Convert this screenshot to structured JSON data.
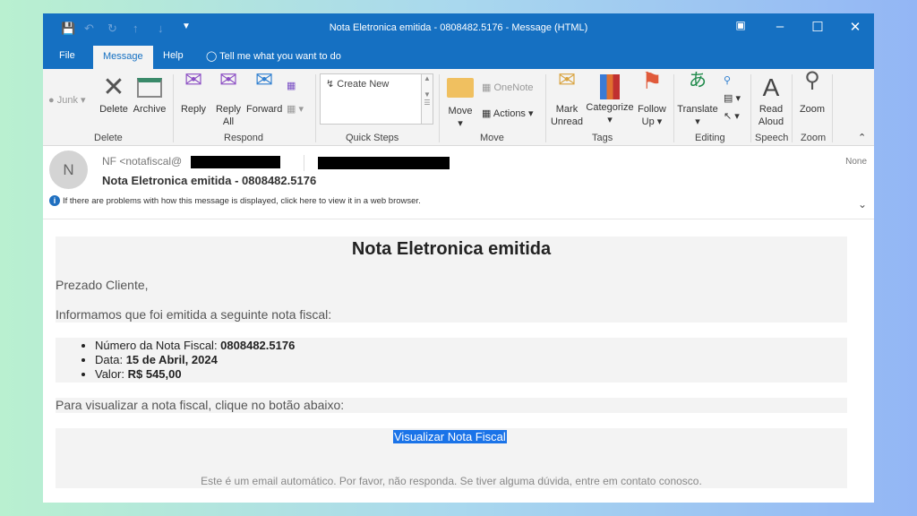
{
  "window": {
    "title": "Nota Eletronica emitida - 0808482.5176  -  Message (HTML)"
  },
  "tabs": [
    {
      "label": "File"
    },
    {
      "label": "Message"
    },
    {
      "label": "Help"
    }
  ],
  "tell_me": "Tell me what you want to do",
  "ribbon": {
    "junk": "Junk",
    "delete": "Delete",
    "archive": "Archive",
    "reply": "Reply",
    "reply_all": "Reply All",
    "forward": "Forward",
    "quick_steps_item": "Create New",
    "move": "Move",
    "onenote": "OneNote",
    "actions": "Actions",
    "mark_unread": "Mark Unread",
    "categorize": "Categorize",
    "follow_up": "Follow Up",
    "translate": "Translate",
    "read_aloud": "Read Aloud",
    "zoom": "Zoom",
    "groups": [
      "Delete",
      "Respond",
      "Quick Steps",
      "Move",
      "Tags",
      "Editing",
      "Speech",
      "Zoom"
    ]
  },
  "header": {
    "avatar_initial": "N",
    "from": "NF <notafiscal@",
    "from_end": ">",
    "subject": "Nota Eletronica emitida - 0808482.5176",
    "info": "If there are problems with how this message is displayed, click here to view it in a web browser.",
    "importance": "None"
  },
  "email": {
    "title": "Nota Eletronica emitida",
    "greeting": "Prezado Cliente,",
    "intro": "Informamos que foi emitida a seguinte nota fiscal:",
    "items": [
      {
        "label": "Número da Nota Fiscal: ",
        "value": "0808482.5176"
      },
      {
        "label": "Data: ",
        "value": "15 de Abril, 2024"
      },
      {
        "label": "Valor: ",
        "value": "R$ 545,00"
      }
    ],
    "cta_text": "Para visualizar a nota fiscal, clique no botão abaixo:",
    "button": "Visualizar Nota Fiscal",
    "footer": "Este é um email automático. Por favor, não responda. Se tiver alguma dúvida, entre em contato conosco."
  }
}
